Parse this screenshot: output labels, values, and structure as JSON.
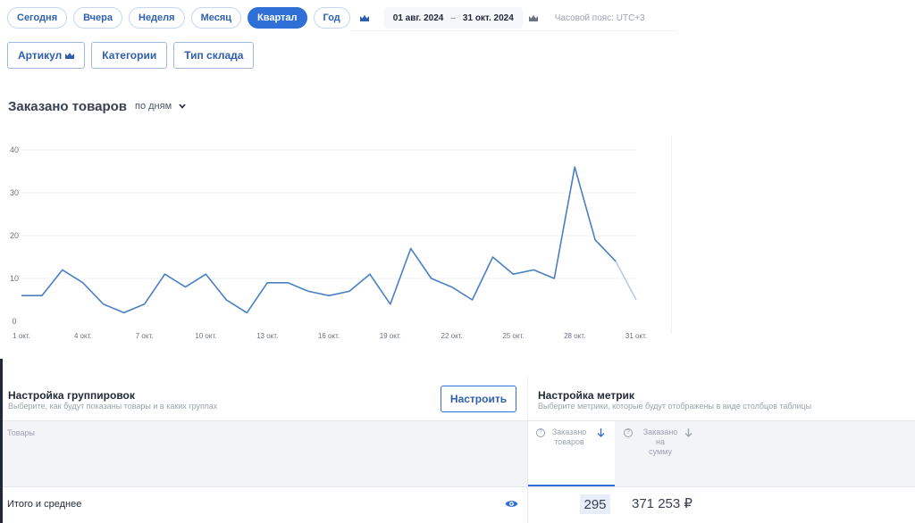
{
  "period_buttons": [
    {
      "label": "Сегодня"
    },
    {
      "label": "Вчера"
    },
    {
      "label": "Неделя"
    },
    {
      "label": "Месяц"
    },
    {
      "label": "Квартал",
      "active": true
    },
    {
      "label": "Год"
    }
  ],
  "date_range": {
    "from": "01 авг. 2024",
    "separator": "–",
    "to": "31 окт. 2024"
  },
  "timezone": "Часовой пояс: UTC+3",
  "filters": {
    "article": "Артикул",
    "categories": "Категории",
    "warehouse_type": "Тип склада"
  },
  "chart_header": {
    "title": "Заказано товаров",
    "mode": "по дням"
  },
  "chart_data": {
    "type": "line",
    "title": "",
    "xlabel": "",
    "ylabel": "",
    "ylim": [
      0,
      40
    ],
    "yticks": [
      0,
      10,
      20,
      30,
      40
    ],
    "grid": true,
    "color": "#4a7fc1",
    "x": [
      "1 окт.",
      "2 окт.",
      "3 окт.",
      "4 окт.",
      "5 окт.",
      "6 окт.",
      "7 окт.",
      "8 окт.",
      "9 окт.",
      "10 окт.",
      "11 окт.",
      "12 окт.",
      "13 окт.",
      "14 окт.",
      "15 окт.",
      "16 окт.",
      "17 окт.",
      "18 окт.",
      "19 окт.",
      "20 окт.",
      "21 окт.",
      "22 окт.",
      "23 окт.",
      "24 окт.",
      "25 окт.",
      "26 окт.",
      "27 окт.",
      "28 окт.",
      "29 окт.",
      "30 окт.",
      "31 окт."
    ],
    "xtick_labels": [
      "1 окт.",
      "4 окт.",
      "7 окт.",
      "10 окт.",
      "13 окт.",
      "16 окт.",
      "19 окт.",
      "22 окт.",
      "25 окт.",
      "28 окт.",
      "31 окт."
    ],
    "values": [
      6,
      6,
      12,
      9,
      4,
      2,
      4,
      11,
      8,
      11,
      5,
      2,
      9,
      9,
      7,
      6,
      7,
      11,
      4,
      17,
      10,
      8,
      5,
      15,
      11,
      12,
      10,
      36,
      19,
      14,
      5
    ]
  },
  "grouping": {
    "title": "Настройка группировок",
    "subtitle": "Выберите, как будут показаны товары и в каких группах",
    "button": "Настроить"
  },
  "metrics": {
    "title": "Настройка метрик",
    "subtitle": "Выберите метрики, которые будут отображены в виде столбцов таблицы"
  },
  "table": {
    "col_goods": "Товары",
    "col_ordered_line1": "Заказано",
    "col_ordered_line2": "товаров",
    "col_sum_line1": "Заказано",
    "col_sum_line2": "на",
    "col_sum_line3": "сумму",
    "total_label": "Итого и среднее",
    "total_ordered": "295",
    "total_sum": "371 253 ₽"
  }
}
